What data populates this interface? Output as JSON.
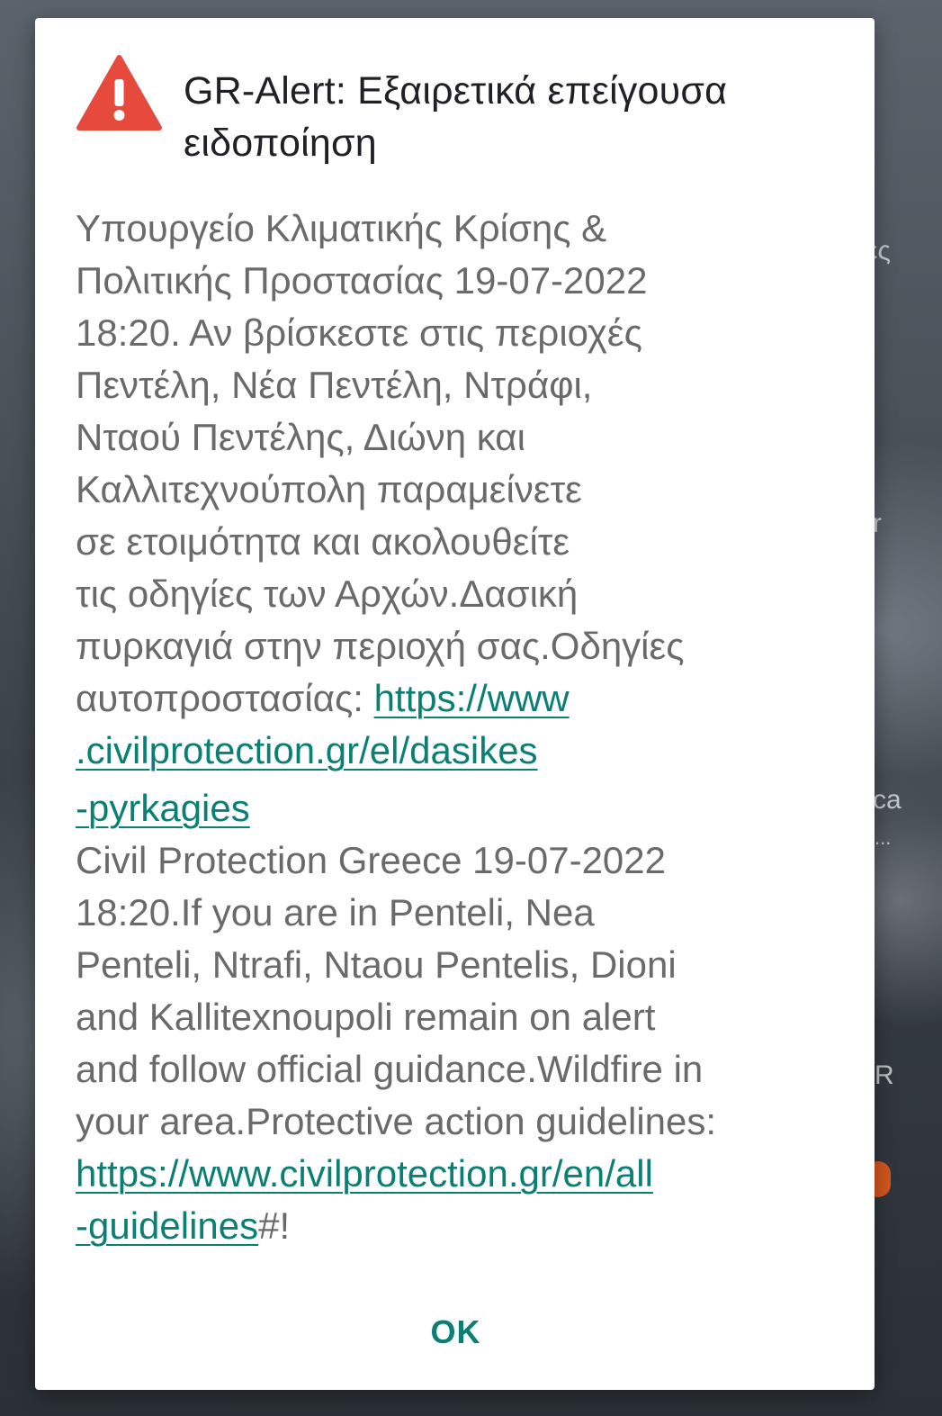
{
  "background": {
    "edge_texts": [
      "ές",
      "r",
      "ca",
      "...",
      "R"
    ]
  },
  "dialog": {
    "title": "GR-Alert: Εξαιρετικά επείγουσα ειδοποίηση",
    "icon": "warning-triangle-icon",
    "accent_color": "#e64a3c",
    "link_color": "#0a7f74",
    "body": {
      "greek_lines": [
        "Υπουργείο Κλιματικής Κρίσης &",
        "Πολιτικής Προστασίας 19-07-2022",
        "18:20. Αν βρίσκεστε στις περιοχές",
        "Πεντέλη, Νέα Πεντέλη, Ντράφι,",
        "Νταού Πεντέλης, Διώνη και",
        "Καλλιτεχνούπολη παραμείνετε",
        "σε ετοιμότητα και ακολουθείτε",
        "τις οδηγίες των Αρχών.Δασική",
        "πυρκαγιά στην περιοχή σας.Οδηγίες"
      ],
      "greek_link_prefix": "αυτοπροστασίας: ",
      "greek_link_lines": [
        "https://www",
        ".civilprotection.gr/el/dasikes",
        "-pyrkagies"
      ],
      "english_lines": [
        "Civil Protection Greece 19-07-2022",
        "18:20.If you are in Penteli, Nea",
        "Penteli, Ntrafi, Ntaou Pentelis, Dioni",
        "and Kallitexnoupoli remain on alert",
        "and follow official guidance.Wildfire in",
        "your area.Protective action guidelines:"
      ],
      "english_link_lines": [
        "https://www.civilprotection.gr/en/all",
        "-guidelines"
      ],
      "english_link_suffix": "#!"
    },
    "ok_label": "OK"
  }
}
